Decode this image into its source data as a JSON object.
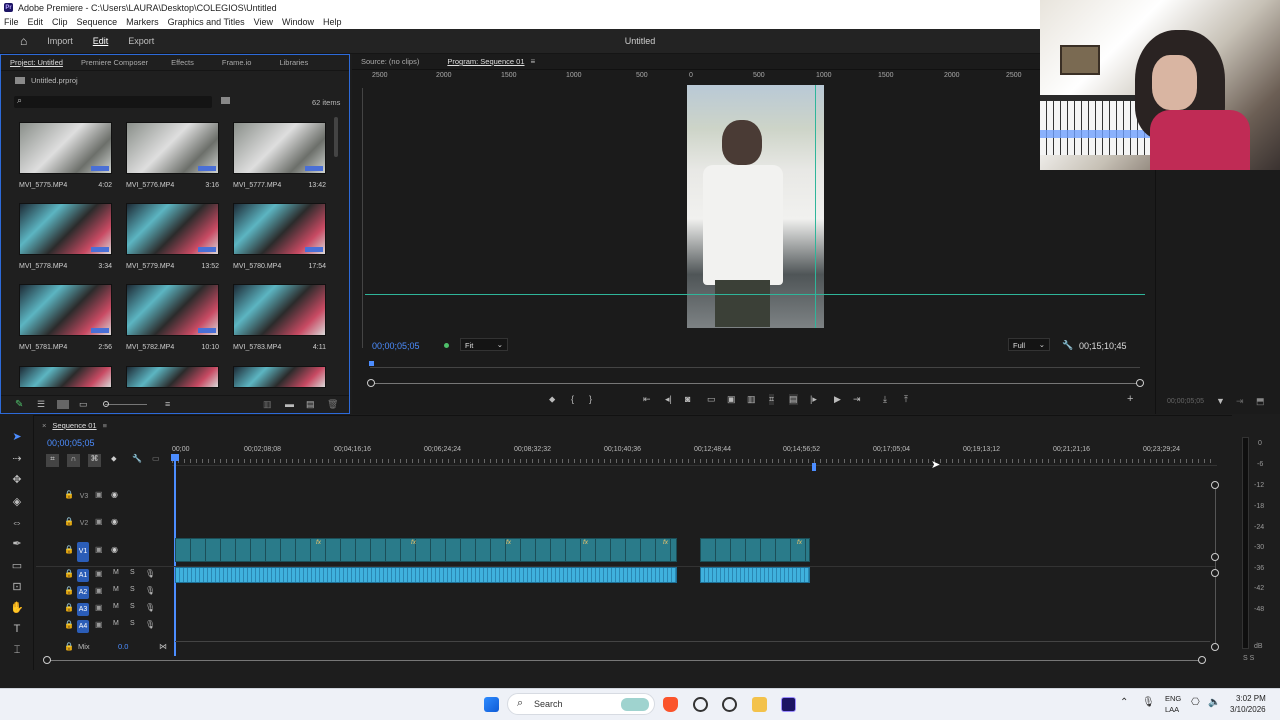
{
  "window": {
    "title": "Adobe Premiere - C:\\Users\\LAURA\\Desktop\\COLEGIOS\\Untitled",
    "app_icon": "Pr"
  },
  "menu": [
    "File",
    "Edit",
    "Clip",
    "Sequence",
    "Markers",
    "Graphics and Titles",
    "View",
    "Window",
    "Help"
  ],
  "header": {
    "tabs": [
      "Import",
      "Edit",
      "Export"
    ],
    "active": "Edit",
    "doc_title": "Untitled"
  },
  "project": {
    "tabs": [
      "Project: Untitled",
      "Premiere Composer",
      "Effects",
      "Frame.io",
      "Libraries"
    ],
    "file": "Untitled.prproj",
    "items_count": "62 items",
    "clips": [
      {
        "name": "MVI_5775.MP4",
        "dur": "4:02"
      },
      {
        "name": "MVI_5776.MP4",
        "dur": "3:16"
      },
      {
        "name": "MVI_5777.MP4",
        "dur": "13:42"
      },
      {
        "name": "MVI_5778.MP4",
        "dur": "3:34"
      },
      {
        "name": "MVI_5779.MP4",
        "dur": "13:52"
      },
      {
        "name": "MVI_5780.MP4",
        "dur": "17:54"
      },
      {
        "name": "MVI_5781.MP4",
        "dur": "2:56"
      },
      {
        "name": "MVI_5782.MP4",
        "dur": "10:10"
      },
      {
        "name": "MVI_5783.MP4",
        "dur": "4:11"
      }
    ]
  },
  "monitor": {
    "source_tab": "Source: (no clips)",
    "program_tab": "Program: Sequence 01",
    "ruler": [
      "2500",
      "2000",
      "1500",
      "1000",
      "500",
      "0",
      "500",
      "1000",
      "1500",
      "2000",
      "2500"
    ],
    "timecode": "00;00;05;05",
    "zoom": "Fit",
    "quality": "Full",
    "duration": "00;15;10;45",
    "aside_time": "00;00;05;05"
  },
  "timeline": {
    "sequence": "Sequence 01",
    "timecode": "00;00;05;05",
    "ruler": [
      "00;00",
      "00;02;08;08",
      "00;04;16;16",
      "00;06;24;24",
      "00;08;32;32",
      "00;10;40;36",
      "00;12;48;44",
      "00;14;56;52",
      "00;17;05;04",
      "00;19;13;12",
      "00;21;21;16",
      "00;23;29;24"
    ],
    "video_tracks": [
      "V3",
      "V2",
      "V1"
    ],
    "audio_tracks": [
      "A1",
      "A2",
      "A3",
      "A4"
    ],
    "mix_label": "Mix",
    "mix_value": "0.0",
    "track_toggles": [
      "M",
      "S"
    ],
    "fx_label": "fx"
  },
  "meters": {
    "scale": [
      "0",
      "-6",
      "-12",
      "-18",
      "-24",
      "-30",
      "-36",
      "-42",
      "-48",
      "dB"
    ],
    "footer": "S S"
  },
  "taskbar": {
    "search": "Search",
    "lang1": "ENG",
    "lang2": "LAA",
    "time": "3:02 PM",
    "date": "3/10/2026"
  },
  "colors": {
    "accent": "#2d6ad9",
    "clip_video": "#2a7b8a",
    "clip_audio": "#3fb1dd",
    "guide": "#2fb59a"
  }
}
